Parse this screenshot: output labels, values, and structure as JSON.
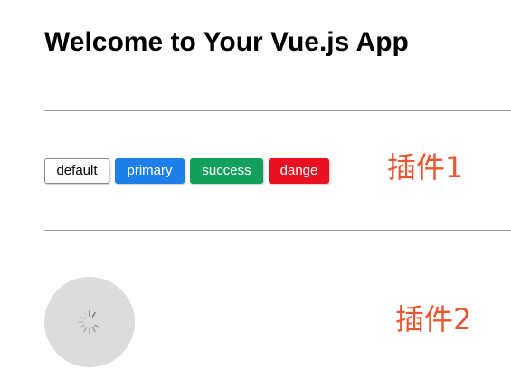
{
  "header": {
    "title": "Welcome to Your Vue.js App"
  },
  "plugin1": {
    "label": "插件1",
    "buttons": [
      {
        "label": "default",
        "variant": "default",
        "color": "#ffffff"
      },
      {
        "label": "primary",
        "variant": "primary",
        "color": "#1e7fe8"
      },
      {
        "label": "success",
        "variant": "success",
        "color": "#12a05c"
      },
      {
        "label": "dange",
        "variant": "danger",
        "color": "#ea1021"
      }
    ]
  },
  "plugin2": {
    "label": "插件2",
    "spinner": {
      "icon": "loading-spinner-icon",
      "background": "#dcdcdc"
    }
  },
  "colors": {
    "label_accent": "#e8552e"
  }
}
